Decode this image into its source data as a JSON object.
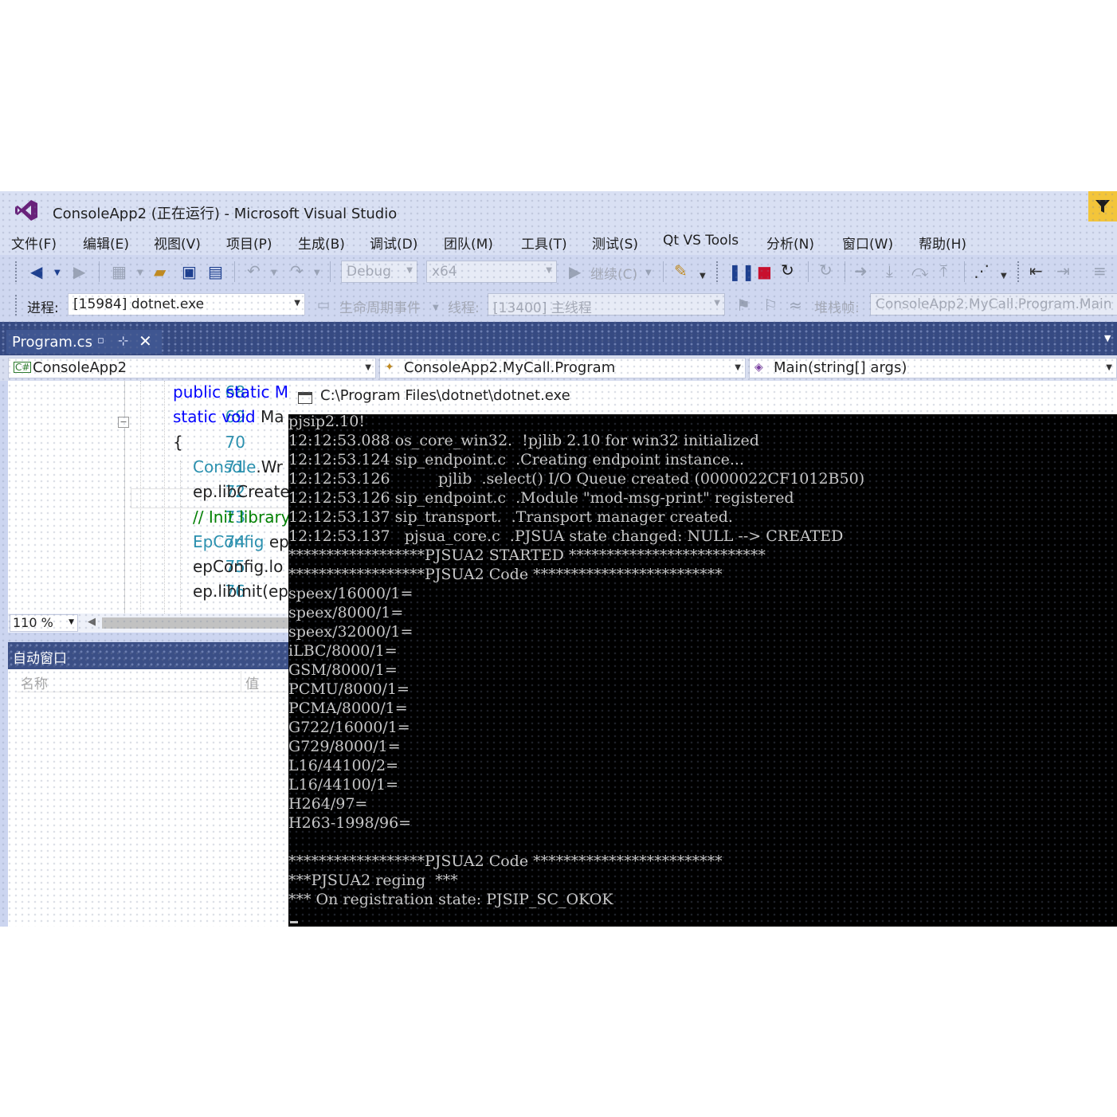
{
  "window": {
    "title": "ConsoleApp2 (正在运行) - Microsoft Visual Studio"
  },
  "menu": [
    "文件(F)",
    "编辑(E)",
    "视图(V)",
    "项目(P)",
    "生成(B)",
    "调试(D)",
    "团队(M)",
    "工具(T)",
    "测试(S)",
    "Qt VS Tools",
    "分析(N)",
    "窗口(W)",
    "帮助(H)"
  ],
  "toolbar": {
    "config": "Debug",
    "platform": "x64",
    "continue_label": "继续(C)"
  },
  "debug_location": {
    "process_label": "进程:",
    "process_value": "[15984] dotnet.exe",
    "lifecycle_label": "生命周期事件",
    "thread_label": "线程:",
    "thread_value": "[13400] 主线程",
    "stack_label": "堆栈帧:",
    "stack_value": "ConsoleApp2.MyCall.Program.Main"
  },
  "doc_tab": {
    "label": "Program.cs"
  },
  "navbar": {
    "project": "ConsoleApp2",
    "type": "ConsoleApp2.MyCall.Program",
    "member": "Main(string[] args)"
  },
  "editor": {
    "line_numbers": [
      "68",
      "69",
      "70",
      "71",
      "72",
      "73",
      "74",
      "75",
      "76"
    ],
    "lines": [
      [
        {
          "t": "public static M",
          "c": "kw"
        }
      ],
      [
        {
          "t": "static void ",
          "c": "kw"
        },
        {
          "t": "Ma",
          "c": "pl"
        }
      ],
      [
        {
          "t": "{",
          "c": "pl"
        }
      ],
      [
        {
          "t": "Console",
          "c": "tp"
        },
        {
          "t": ".Wr",
          "c": "pl"
        }
      ],
      [
        {
          "t": "ep.libCreate",
          "c": "pl"
        }
      ],
      [
        {
          "t": "// Init library",
          "c": "cm"
        }
      ],
      [
        {
          "t": "EpConfig ",
          "c": "tp"
        },
        {
          "t": "ep",
          "c": "pl"
        }
      ],
      [
        {
          "t": "epConfig.lo",
          "c": "pl"
        }
      ],
      [
        {
          "t": "ep.libInit(ep",
          "c": "pl"
        }
      ]
    ],
    "zoom": "110 %"
  },
  "auto_window": {
    "title": "自动窗口",
    "col_name": "名称",
    "col_value": "值"
  },
  "console": {
    "title": "C:\\Program Files\\dotnet\\dotnet.exe",
    "lines": [
      "pjsip2.10!",
      "12:12:53.088 os_core_win32.  !pjlib 2.10 for win32 initialized",
      "12:12:53.124 sip_endpoint.c  .Creating endpoint instance...",
      "12:12:53.126          pjlib  .select() I/O Queue created (0000022CF1012B50)",
      "12:12:53.126 sip_endpoint.c  .Module \"mod-msg-print\" registered",
      "12:12:53.137 sip_transport.  .Transport manager created.",
      "12:12:53.137   pjsua_core.c  .PJSUA state changed: NULL --> CREATED",
      "******************PJSUA2 STARTED **************************",
      "******************PJSUA2 Code *************************",
      "speex/16000/1=",
      "speex/8000/1=",
      "speex/32000/1=",
      "iLBC/8000/1=",
      "GSM/8000/1=",
      "PCMU/8000/1=",
      "PCMA/8000/1=",
      "G722/16000/1=",
      "G729/8000/1=",
      "L16/44100/2=",
      "L16/44100/1=",
      "H264/97=",
      "H263-1998/96=",
      "",
      "******************PJSUA2 Code *************************",
      "***PJSUA2 reging  ***",
      "*** On registration state: PJSIP_SC_OKOK"
    ]
  },
  "colors": {
    "chrome": "#cfd7f0",
    "tab_strip": "#364a82",
    "filter_button": "#f3c53a",
    "vs_purple": "#68217a",
    "console_bg": "#000000",
    "console_fg": "#c8c8c8"
  },
  "icons": [
    "vs-logo-icon",
    "filter-icon",
    "back-icon",
    "forward-icon",
    "save-icon",
    "save-all-icon",
    "undo-icon",
    "redo-icon",
    "start-icon",
    "pause-icon",
    "stop-icon",
    "restart-icon",
    "close-icon",
    "pin-icon",
    "csharp-icon",
    "class-icon",
    "method-icon",
    "console-window-icon"
  ]
}
